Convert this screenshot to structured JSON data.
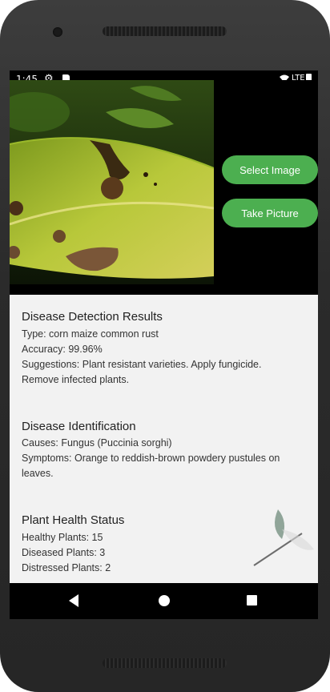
{
  "status_bar": {
    "time": "1:45",
    "network": "LTE"
  },
  "actions": {
    "select_image": "Select Image",
    "take_picture": "Take Picture"
  },
  "results": {
    "title": "Disease Detection Results",
    "type": "Type: corn maize common rust",
    "accuracy": "Accuracy: 99.96%",
    "suggestions_1": "Suggestions: Plant resistant varieties. Apply fungicide.",
    "suggestions_2": "Remove infected plants."
  },
  "identification": {
    "title": "Disease Identification",
    "causes": "Causes: Fungus (Puccinia sorghi)",
    "symptoms_1": "Symptoms: Orange to reddish-brown powdery pustules on",
    "symptoms_2": "leaves."
  },
  "health": {
    "title": "Plant Health Status",
    "healthy": "Healthy Plants: 15",
    "diseased": "Diseased Plants: 3",
    "distressed": "Distressed Plants: 2"
  },
  "colors": {
    "accent": "#4caf50",
    "card_bg": "#f2f2f2",
    "screen_bg": "#000000"
  },
  "icons": [
    "settings-gear-icon",
    "sd-card-icon",
    "wifi-icon",
    "battery-icon",
    "back-icon",
    "home-icon",
    "recents-icon"
  ]
}
